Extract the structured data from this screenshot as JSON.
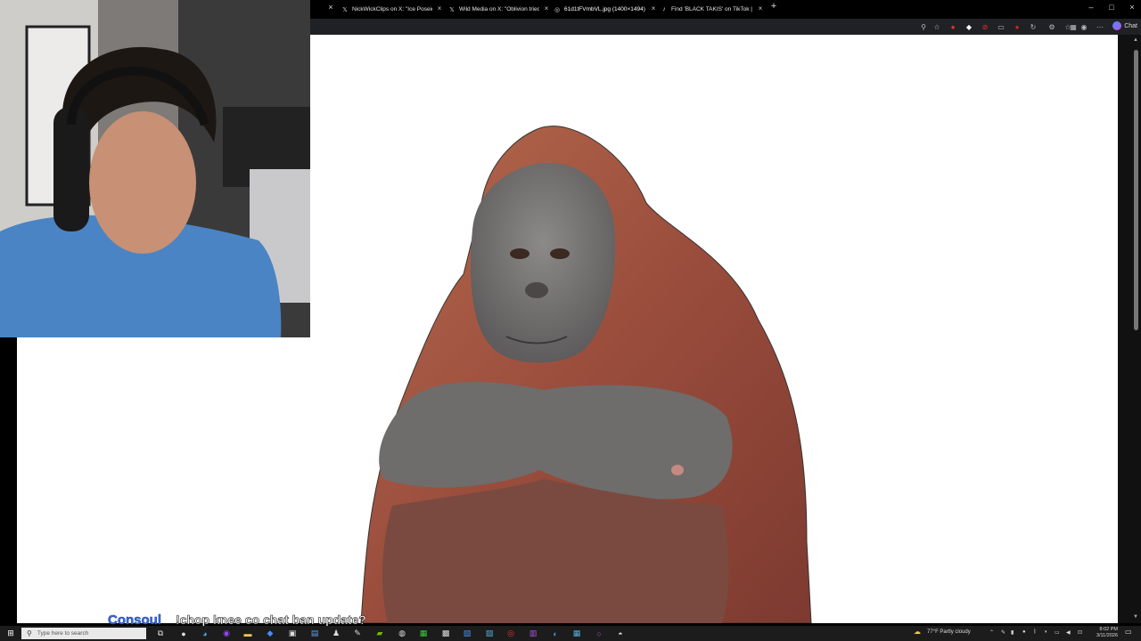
{
  "browser": {
    "tabs": [
      {
        "icon": "x-logo-icon",
        "glyph": "𝕏",
        "label": "NickWickClips on X: \"Ice Poseidon",
        "active": false
      },
      {
        "icon": "x-logo-icon",
        "glyph": "𝕏",
        "label": "Wild Media on X: \"Oblivion tried",
        "active": false
      },
      {
        "icon": "globe-icon",
        "glyph": "◎",
        "label": "61d1tFVmbVL.jpg (1400×1494)",
        "active": true
      },
      {
        "icon": "tiktok-icon",
        "glyph": "♪",
        "label": "Find 'BLACK TAKIS' on TikTok | Tik",
        "active": false
      }
    ],
    "new_tab_glyph": "+",
    "close_glyph": "×",
    "window_controls": {
      "minimize": "–",
      "maximize": "□",
      "close": "×"
    },
    "toolbar": {
      "chat_label": "Chat"
    }
  },
  "content": {
    "image_icon": "orangutan-image"
  },
  "overlay": {
    "username": "Consoul",
    "message": "!chop knee co chat ban update?"
  },
  "taskbar": {
    "search_placeholder": "Type here to search",
    "weather": "77°F  Partly cloudy",
    "time": "8:02 PM",
    "date": "3/11/2026"
  },
  "colors": {
    "accent": "#3a6fd8",
    "tab_bg": "#000000",
    "toolbar_bg": "#202124",
    "taskbar_bg": "#1c1c1c"
  }
}
